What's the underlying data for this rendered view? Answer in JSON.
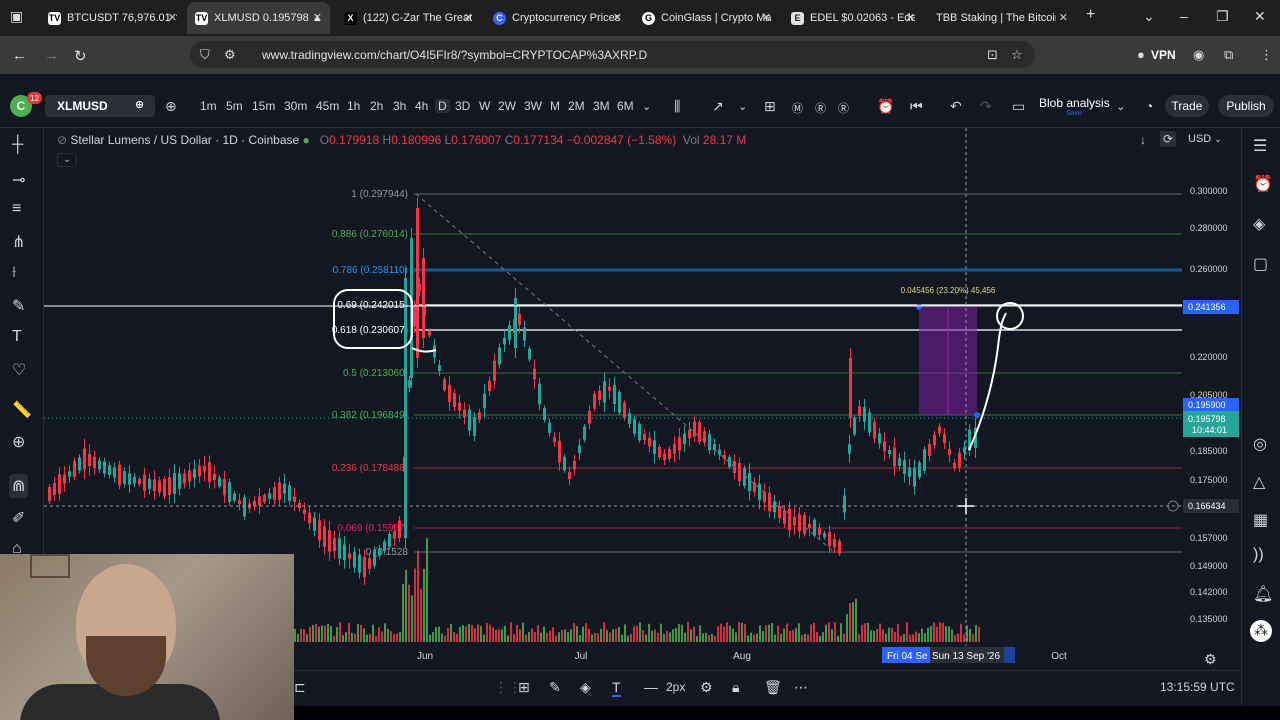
{
  "browser": {
    "tabs": [
      {
        "label": "BTCUSDT 76,976.01 ▼",
        "favicon": "TV",
        "active": false
      },
      {
        "label": "XLMUSD 0.195798 ▲",
        "favicon": "TV",
        "active": true
      },
      {
        "label": "(122) C-Zar The Great",
        "favicon": "X",
        "active": false
      },
      {
        "label": "Cryptocurrency Prices",
        "favicon": "C",
        "active": false
      },
      {
        "label": "CoinGlass | Crypto Ma",
        "favicon": "G",
        "active": false
      },
      {
        "label": "EDEL $0.02063 - Edel /",
        "favicon": "E",
        "active": false
      },
      {
        "label": "TBB Staking | The Bitcoin B",
        "favicon": "",
        "active": false
      }
    ],
    "url": "www.tradingview.com/chart/O4I5FIr8/?symbol=CRYPTOCAP%3AXRP.D",
    "vpn_label": "VPN"
  },
  "toolbar": {
    "avatar_letter": "C",
    "notification_count": "12",
    "symbol": "XLMUSD",
    "timeframes": [
      "1m",
      "5m",
      "15m",
      "30m",
      "45m",
      "1h",
      "2h",
      "3h",
      "4h",
      "D",
      "3D",
      "W",
      "2W",
      "3W",
      "M",
      "2M",
      "3M",
      "6M"
    ],
    "active_timeframe": "D",
    "layout_name": "Blob analysis",
    "layout_status": "Save",
    "trade_label": "Trade",
    "publish_label": "Publish"
  },
  "legend": {
    "title": "Stellar Lumens / US Dollar · 1D · Coinbase",
    "open_label": "O",
    "open": "0.179918",
    "high_label": "H",
    "high": "0.180996",
    "low_label": "L",
    "low": "0.176007",
    "close_label": "C",
    "close": "0.177134",
    "change": "−0.002847 (−1.58%)",
    "vol_label": "Vol",
    "vol": "28.17 M"
  },
  "currency": "USD",
  "chart_data": {
    "type": "candlestick",
    "price_axis": {
      "ticks": [
        "0.300000",
        "0.280000",
        "0.260000",
        "0.220000",
        "0.205000",
        "0.185000",
        "0.175000",
        "0.157000",
        "0.149000",
        "0.142000",
        "0.135000"
      ],
      "labels": [
        {
          "text": "0.241356",
          "color": "#2962ff"
        },
        {
          "text": "0.195900",
          "color": "#2962ff"
        },
        {
          "text": "0.195798",
          "color": "#2962ff"
        },
        {
          "text": "0.166434",
          "color": "#2a2e39"
        }
      ],
      "countdown": "10:44:01"
    },
    "time_axis": {
      "ticks": [
        "Jun",
        "Jul",
        "Aug",
        "Oct"
      ],
      "selected_range": "Fri 04 Se",
      "cursor_label": "Sun 13 Sep '26"
    },
    "fibonacci": [
      {
        "label": "1 (0.297944)",
        "color": "#9598a1"
      },
      {
        "label": "0.886 (0.276014)",
        "color": "#4caf50"
      },
      {
        "label": "0.786 (0.258110)",
        "color": "#2196f3"
      },
      {
        "label": "0.69 (0.242015)",
        "color": "#ffffff"
      },
      {
        "label": "0.618 (0.230607)",
        "color": "#ffffff"
      },
      {
        "label": "0.5 (0.213060)",
        "color": "#4caf50"
      },
      {
        "label": "0.382 (0.196849)",
        "color": "#4caf50"
      },
      {
        "label": "0.236 (0.178488)",
        "color": "#f23645"
      },
      {
        "label": "0.069 (0.15957)",
        "color": "#e91e63"
      },
      {
        "label": "0 (0.1528",
        "color": "#9598a1"
      }
    ],
    "measure_label": "0.045456 (23.20%) 45,456",
    "colors": {
      "up": "#26a69a",
      "down": "#f23645",
      "vol_up": "#4caf50",
      "vol_down": "#f23645",
      "measure": "#7b1fa2"
    }
  },
  "bottombar": {
    "stroke_width": "2px",
    "clock": "13:15:59 UTC"
  },
  "icons": {
    "left_tools": [
      "cursor-icon",
      "dot-icon",
      "lines-icon",
      "pitchfork-icon",
      "measure-tool-icon",
      "brush-icon",
      "text-icon",
      "heart-icon",
      "ruler-icon",
      "zoom-icon",
      "magnet-icon",
      "pencil-lock-icon",
      "lock-icon"
    ],
    "right_tools": [
      "watchlist-icon",
      "alarm-icon",
      "layers-icon",
      "chat-icon",
      "target-icon",
      "triangle-icon",
      "calendar-icon",
      "signal-icon",
      "bell-icon",
      "grid-icon"
    ]
  }
}
